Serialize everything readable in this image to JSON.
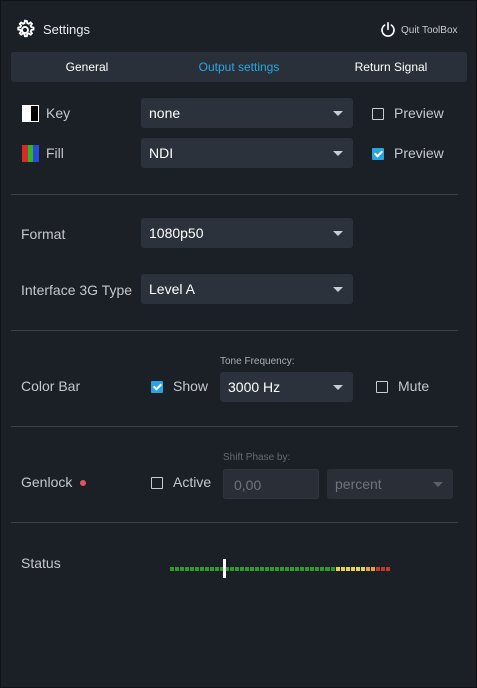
{
  "header": {
    "title": "Settings",
    "quit_label": "Quit ToolBox",
    "icons": {
      "settings": "gear-icon",
      "quit": "power-icon"
    }
  },
  "tabs": [
    {
      "label": "General",
      "active": false
    },
    {
      "label": "Output settings",
      "active": true
    },
    {
      "label": "Return Signal",
      "active": false
    }
  ],
  "key": {
    "label": "Key",
    "value": "none",
    "preview_label": "Preview",
    "preview_checked": false
  },
  "fill": {
    "label": "Fill",
    "value": "NDI",
    "preview_label": "Preview",
    "preview_checked": true
  },
  "format": {
    "label": "Format",
    "value": "1080p50"
  },
  "interface": {
    "label": "Interface 3G Type",
    "value": "Level A"
  },
  "colorbar": {
    "label": "Color Bar",
    "show_label": "Show",
    "show_checked": true,
    "tone_caption": "Tone Frequency:",
    "tone_value": "3000 Hz",
    "mute_label": "Mute",
    "mute_checked": false
  },
  "genlock": {
    "label": "Genlock",
    "status_color": "#e0555a",
    "active_label": "Active",
    "active_checked": false,
    "shift_caption": "Shift Phase by:",
    "shift_value": "0,00",
    "unit_value": "percent"
  },
  "status": {
    "label": "Status",
    "meter_segments": 44,
    "meter_level": 0.25,
    "colors": {
      "green": "#2e9a2a",
      "yellow": "#e8d44a",
      "orange": "#e8a23a",
      "red": "#c43a2a"
    }
  },
  "colors": {
    "accent": "#2ba7df",
    "background": "#1b1f26",
    "panel": "#2b323c"
  }
}
